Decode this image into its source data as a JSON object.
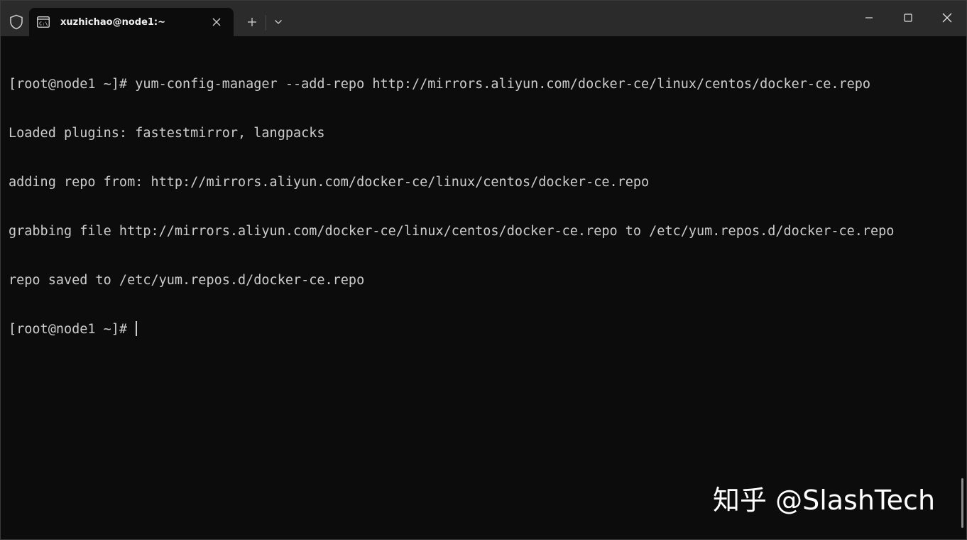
{
  "window": {
    "tab_title": "xuzhichao@node1:~",
    "new_tab_label": "+",
    "icons": {
      "shield": "shield-icon",
      "tab": "terminal-icon",
      "close_tab": "close-icon",
      "new_tab": "plus-icon",
      "dropdown": "chevron-down-icon",
      "minimize": "minimize-icon",
      "maximize": "maximize-icon",
      "close": "close-icon"
    }
  },
  "terminal": {
    "lines": [
      "[root@node1 ~]# yum-config-manager --add-repo http://mirrors.aliyun.com/docker-ce/linux/centos/docker-ce.repo",
      "Loaded plugins: fastestmirror, langpacks",
      "adding repo from: http://mirrors.aliyun.com/docker-ce/linux/centos/docker-ce.repo",
      "grabbing file http://mirrors.aliyun.com/docker-ce/linux/centos/docker-ce.repo to /etc/yum.repos.d/docker-ce.repo",
      "repo saved to /etc/yum.repos.d/docker-ce.repo"
    ],
    "prompt": "[root@node1 ~]# "
  },
  "watermark": "知乎 @SlashTech",
  "colors": {
    "background": "#0c0c0c",
    "titlebar": "#2b2b2b",
    "text": "#cccccc"
  }
}
